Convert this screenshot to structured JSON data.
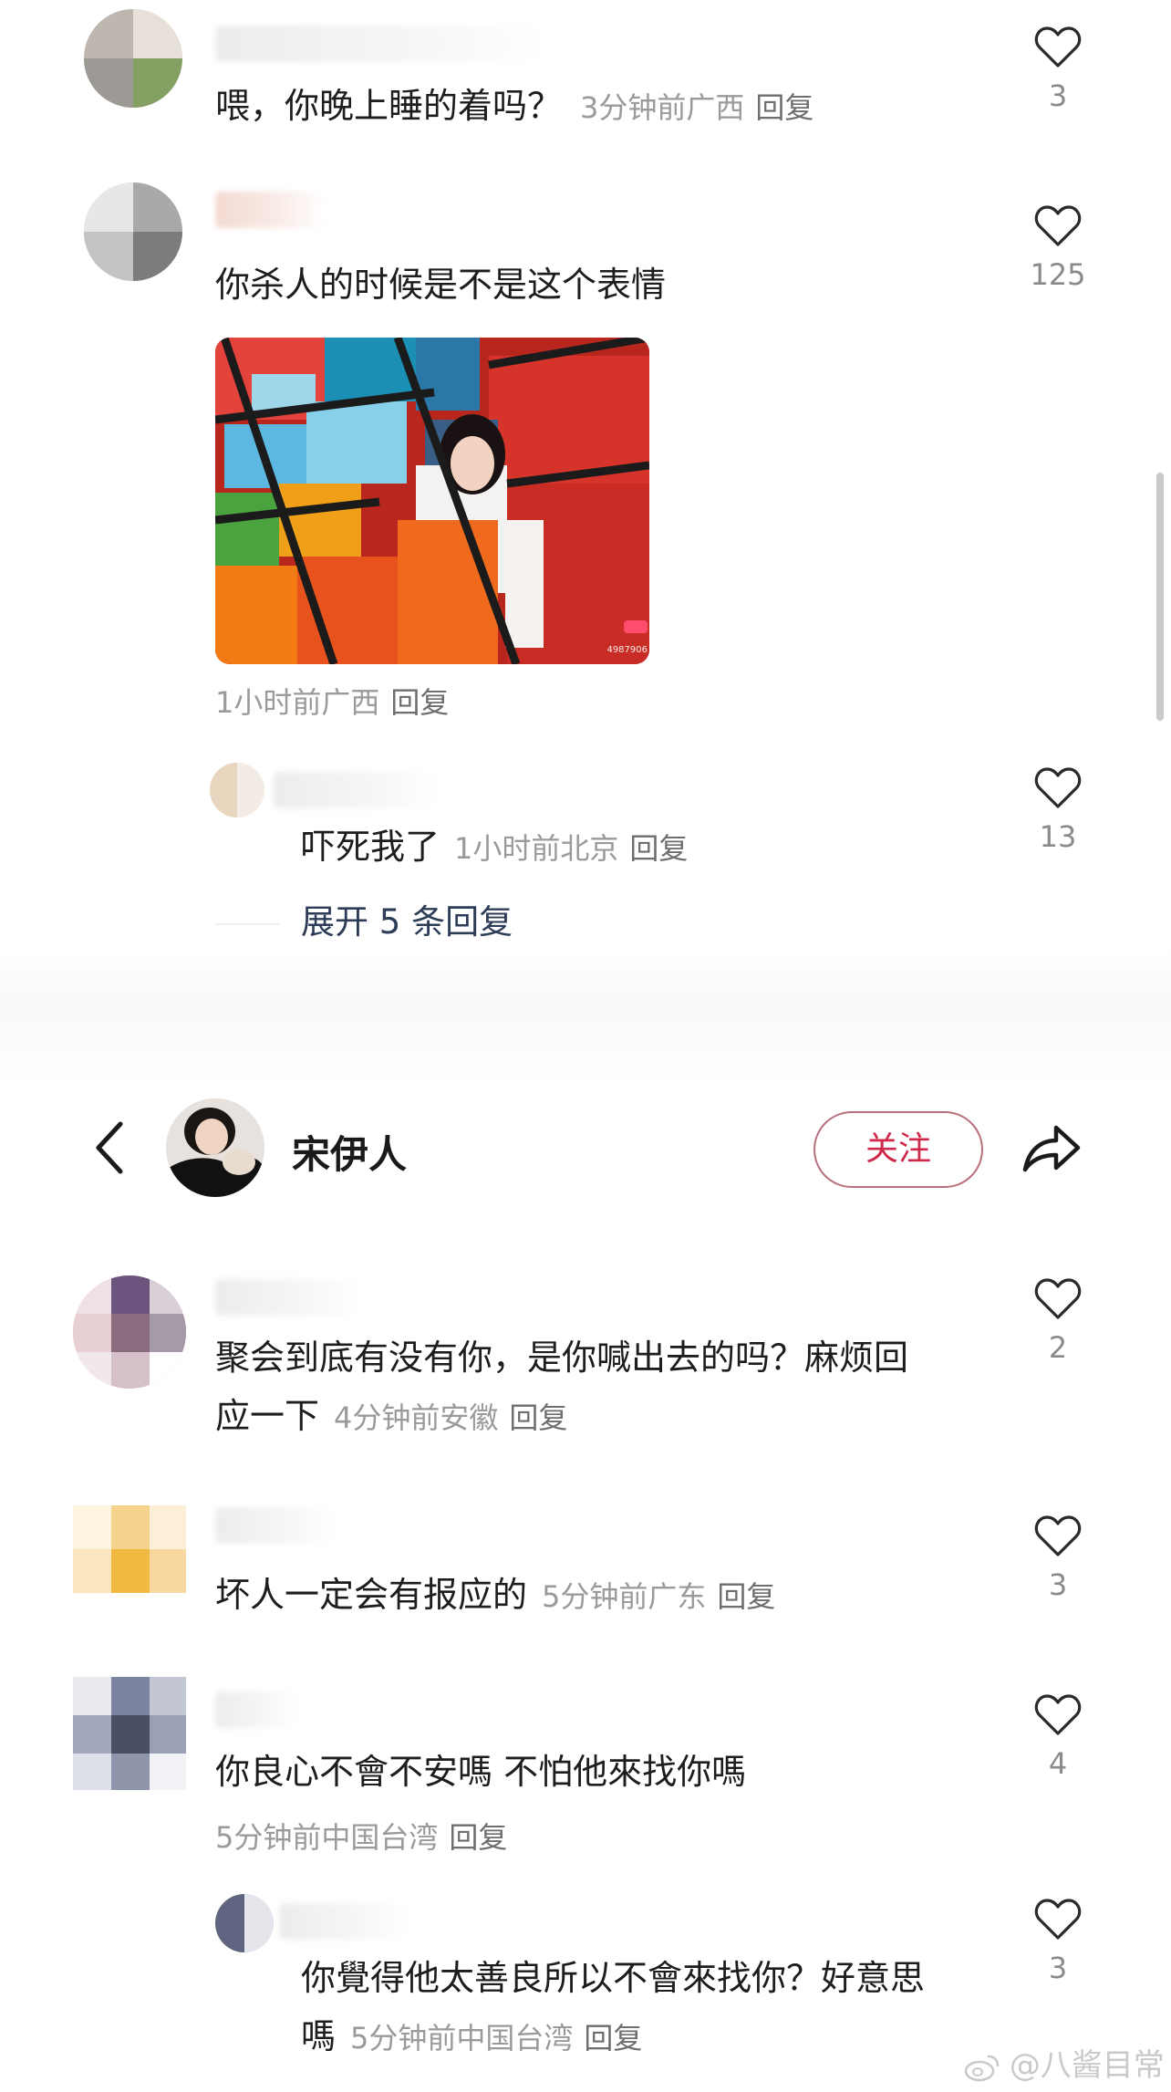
{
  "top_section": {
    "comments": [
      {
        "text": "喂，你晚上睡的着吗？",
        "time": "3分钟前",
        "location": "广西",
        "reply_label": "回复",
        "likes": "3"
      },
      {
        "text": "你杀人的时候是不是这个表情",
        "time": "1小时前",
        "location": "广西",
        "reply_label": "回复",
        "likes": "125",
        "image_corner_text": "4987906"
      }
    ],
    "sub_reply": {
      "text": "吓死我了",
      "time": "1小时前",
      "location": "北京",
      "reply_label": "回复",
      "likes": "13"
    },
    "expand_label": "展开 5 条回复"
  },
  "header": {
    "username": "宋伊人",
    "follow_label": "关注",
    "icons": [
      "back-chevron-icon",
      "share-arrow-icon"
    ]
  },
  "bottom_section": {
    "comments": [
      {
        "text_line1": "聚会到底有没有你，是你喊出去的吗？麻烦回",
        "text_line2": "应一下",
        "time": "4分钟前",
        "location": "安徽",
        "reply_label": "回复",
        "likes": "2"
      },
      {
        "text": "坏人一定会有报应的",
        "time": "5分钟前",
        "location": "广东",
        "reply_label": "回复",
        "likes": "3"
      },
      {
        "text": "你良心不會不安嗎 不怕他來找你嗎",
        "time": "5分钟前",
        "location": "中国台湾",
        "reply_label": "回复",
        "likes": "4"
      }
    ],
    "sub_reply": {
      "text_line1": "你覺得他太善良所以不會來找你？好意思",
      "text_line2": "嗎",
      "time": "5分钟前",
      "location": "中国台湾",
      "reply_label": "回复",
      "likes": "3"
    }
  },
  "watermark": "@八酱目常",
  "colors": {
    "follow_border": "#b8707d",
    "follow_text": "#d0284a",
    "meta_gray": "#9a9a9a",
    "expand_text": "#2d3c57"
  }
}
